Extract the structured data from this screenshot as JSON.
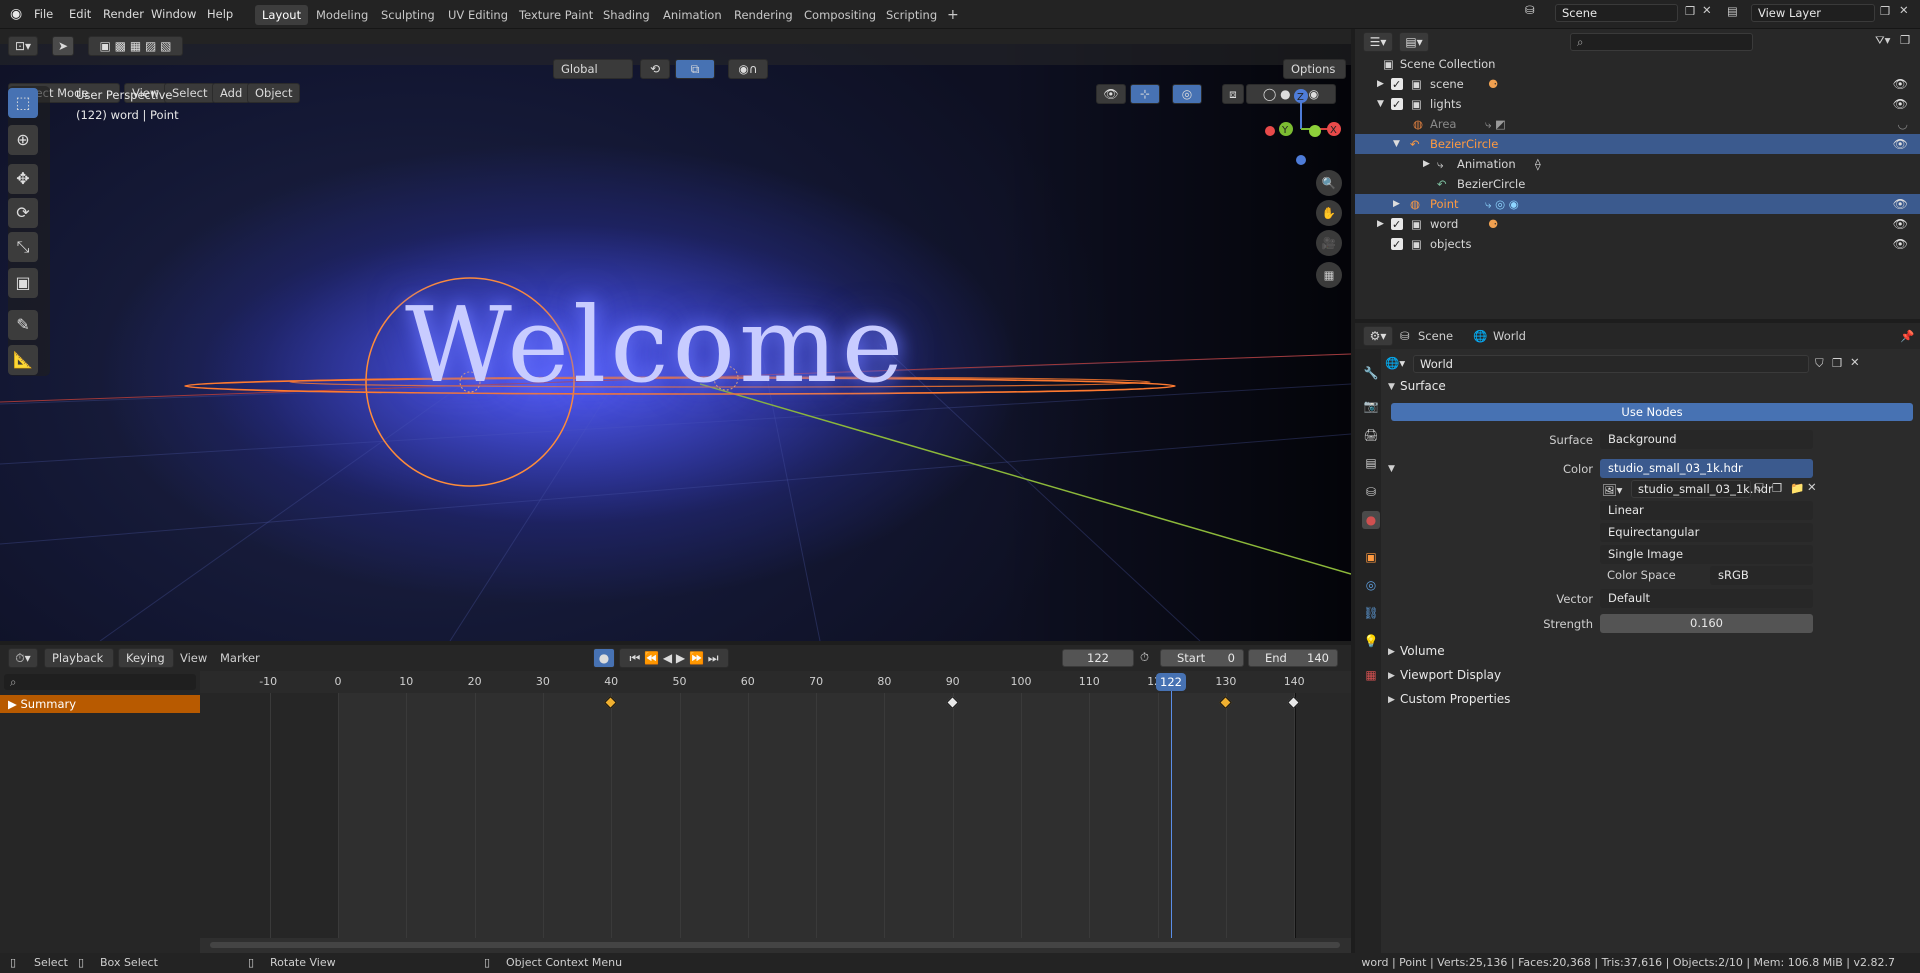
{
  "menu": {
    "file": "File",
    "edit": "Edit",
    "render": "Render",
    "window": "Window",
    "help": "Help"
  },
  "workspaces": [
    "Layout",
    "Modeling",
    "Sculpting",
    "UV Editing",
    "Texture Paint",
    "Shading",
    "Animation",
    "Rendering",
    "Compositing",
    "Scripting"
  ],
  "header": {
    "scene": "Scene",
    "view_layer": "View Layer"
  },
  "viewport": {
    "mode": "Object Mode",
    "view": "View",
    "select": "Select",
    "add": "Add",
    "object": "Object",
    "transform": "Global",
    "options": "Options",
    "perspective": "User Perspective",
    "info": "(122) word | Point",
    "text3d": "Welcome"
  },
  "gizmo": {
    "x": "X",
    "y": "Y",
    "z": "Z"
  },
  "timeline": {
    "playback": "Playback",
    "keying": "Keying",
    "view": "View",
    "marker": "Marker",
    "current_frame": "122",
    "start_label": "Start",
    "start": "0",
    "end_label": "End",
    "end": "140",
    "summary": "Summary",
    "ticks": [
      "-10",
      "0",
      "10",
      "20",
      "30",
      "40",
      "50",
      "60",
      "70",
      "80",
      "90",
      "100",
      "110",
      "120",
      "130",
      "140"
    ],
    "keyframes": [
      40,
      90,
      130,
      140
    ]
  },
  "outliner": {
    "collection": "Scene Collection",
    "rows": [
      {
        "label": "scene",
        "indent": 1
      },
      {
        "label": "lights",
        "indent": 1
      },
      {
        "label": "Area",
        "indent": 2
      },
      {
        "label": "BezierCircle",
        "indent": 2
      },
      {
        "label": "Animation",
        "indent": 3
      },
      {
        "label": "BezierCircle",
        "indent": 4
      },
      {
        "label": "Point",
        "indent": 2
      },
      {
        "label": "word",
        "indent": 1
      },
      {
        "label": "objects",
        "indent": 1
      }
    ]
  },
  "properties": {
    "tab_scene": "Scene",
    "tab_world": "World",
    "world_name": "World",
    "surface_header": "Surface",
    "use_nodes": "Use Nodes",
    "surface_label": "Surface",
    "surface_value": "Background",
    "color_label": "Color",
    "color_value": "studio_small_03_1k.hdr",
    "image_name": "studio_small_03_1k.hdr",
    "interp": "Linear",
    "projection": "Equirectangular",
    "source": "Single Image",
    "colorspace_label": "Color Space",
    "colorspace": "sRGB",
    "vector_label": "Vector",
    "vector_value": "Default",
    "strength_label": "Strength",
    "strength_value": "0.160",
    "volume": "Volume",
    "viewport_display": "Viewport Display",
    "custom_props": "Custom Properties"
  },
  "status": {
    "select": "Select",
    "box_select": "Box Select",
    "rotate": "Rotate View",
    "context": "Object Context Menu",
    "stats": "word | Point | Verts:25,136 | Faces:20,368 | Tris:37,616 | Objects:2/10 | Mem: 106.8 MiB | v2.82.7"
  }
}
